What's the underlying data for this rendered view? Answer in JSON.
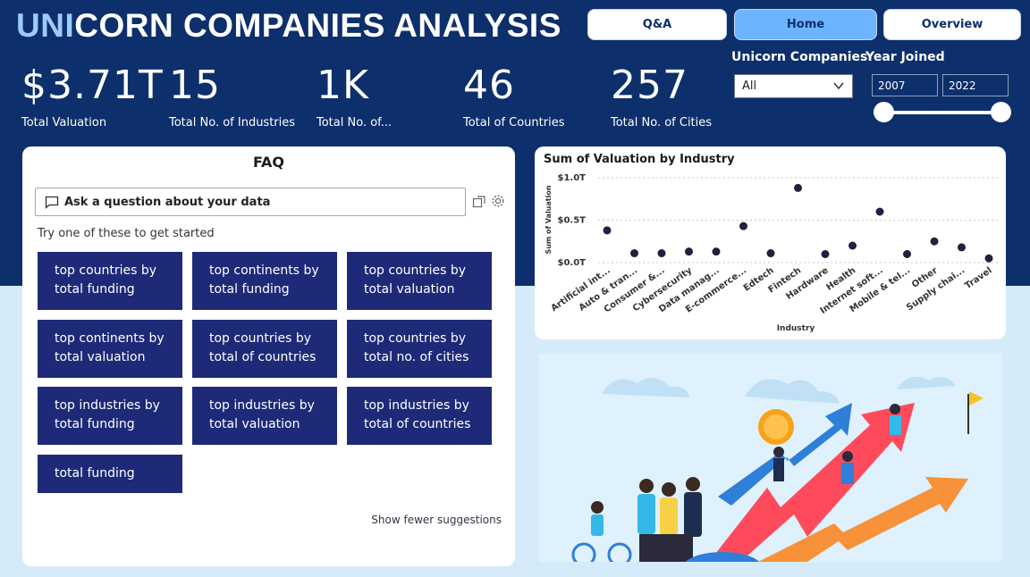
{
  "header": {
    "title_highlight": "UNI",
    "title_rest": "CORN COMPANIES ANALYSIS",
    "nav": [
      {
        "label": "Q&A",
        "active": false
      },
      {
        "label": "Home",
        "active": true
      },
      {
        "label": "Overview",
        "active": false
      }
    ]
  },
  "kpis": [
    {
      "value": "$3.71T",
      "label": "Total Valuation"
    },
    {
      "value": "15",
      "label": "Total No. of Industries"
    },
    {
      "value": "1K",
      "label": "Total No. of..."
    },
    {
      "value": "46",
      "label": "Total of Countries"
    },
    {
      "value": "257",
      "label": "Total No. of Cities"
    }
  ],
  "filters": {
    "companies_label": "Unicorn Companies",
    "companies_value": "All",
    "year_label": "Year Joined",
    "year_from": "2007",
    "year_to": "2022"
  },
  "faq": {
    "title": "FAQ",
    "ask_placeholder": "Ask a question about your data",
    "hint": "Try one of these to get started",
    "suggestions": [
      {
        "line1": "top countries by",
        "line2": "total funding"
      },
      {
        "line1": "top continents by",
        "line2": "total funding"
      },
      {
        "line1": "top countries by",
        "line2": "total valuation"
      },
      {
        "line1": "top continents by",
        "line2": "total valuation"
      },
      {
        "line1": "top countries by",
        "line2": "total of countries"
      },
      {
        "line1": "top countries by",
        "line2": "total no. of cities"
      },
      {
        "line1": "top industries by",
        "line2": "total funding"
      },
      {
        "line1": "top industries by",
        "line2": "total valuation"
      },
      {
        "line1": "top industries by",
        "line2": "total of countries"
      },
      {
        "line1": "total funding",
        "line2": ""
      }
    ],
    "show_fewer": "Show fewer suggestions"
  },
  "chart_data": {
    "type": "scatter",
    "title": "Sum of Valuation by Industry",
    "xlabel": "Industry",
    "ylabel": "Sum of Valuation",
    "ylim": [
      0,
      1.0
    ],
    "yticks": [
      {
        "value": 1.0,
        "label": "$1.0T"
      },
      {
        "value": 0.5,
        "label": "$0.5T"
      },
      {
        "value": 0.0,
        "label": "$0.0T"
      }
    ],
    "grid": true,
    "marker_color": "#1e2240",
    "categories": [
      "Artificial int...",
      "Auto & tran...",
      "Consumer &...",
      "Cybersecurity",
      "Data manag...",
      "E-commerce...",
      "Edtech",
      "Fintech",
      "Hardware",
      "Health",
      "Internet soft...",
      "Mobile & tel...",
      "Other",
      "Supply chai...",
      "Travel"
    ],
    "values": [
      0.38,
      0.11,
      0.11,
      0.13,
      0.13,
      0.43,
      0.11,
      0.88,
      0.1,
      0.2,
      0.6,
      0.1,
      0.25,
      0.18,
      0.05
    ]
  },
  "colors": {
    "banner": "#0d2f6b",
    "active_tab": "#6cb4ff",
    "suggestion_bg": "#1e2a78",
    "page_bg": "#d6ebfa"
  }
}
